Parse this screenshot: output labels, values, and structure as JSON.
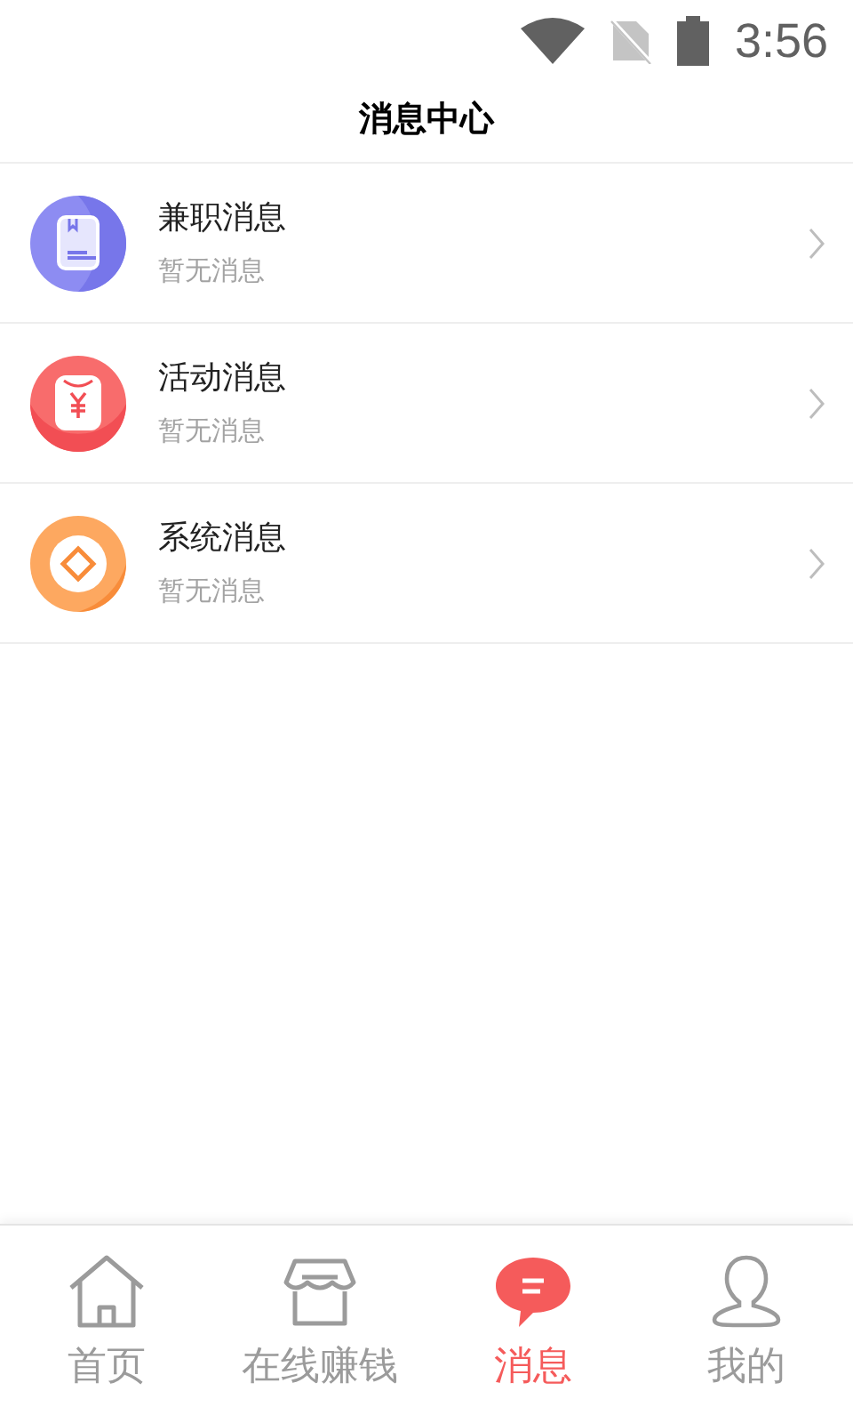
{
  "status_bar": {
    "time": "3:56"
  },
  "header": {
    "title": "消息中心"
  },
  "messages": [
    {
      "kind": "book",
      "title": "兼职消息",
      "preview": "暂无消息"
    },
    {
      "kind": "packet",
      "title": "活动消息",
      "preview": "暂无消息"
    },
    {
      "kind": "coin",
      "title": "系统消息",
      "preview": "暂无消息"
    }
  ],
  "tabs": [
    {
      "kind": "home",
      "label": "首页",
      "selected": false
    },
    {
      "kind": "shop",
      "label": "在线赚钱",
      "selected": false
    },
    {
      "kind": "chat",
      "label": "消息",
      "selected": true
    },
    {
      "kind": "user",
      "label": "我的",
      "selected": false
    }
  ]
}
